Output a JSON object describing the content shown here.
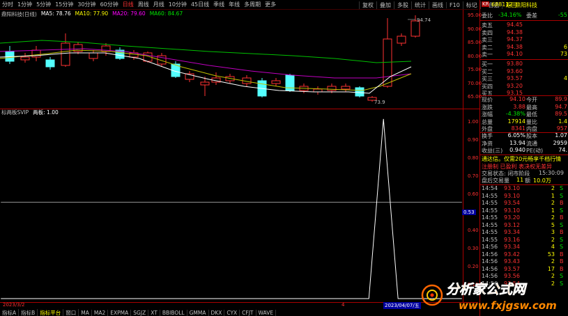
{
  "periods": [
    "分时",
    "1分钟",
    "5分钟",
    "15分钟",
    "30分钟",
    "60分钟",
    "日线",
    "周线",
    "月线",
    "10分钟",
    "45日线",
    "季线",
    "年线",
    "多周期",
    "更多"
  ],
  "active_period": "日线",
  "toolbar": [
    "复权",
    "叠加",
    "多股",
    "统计",
    "画线",
    "F10",
    "标记",
    "+自选",
    "返回"
  ],
  "ma": {
    "stock_label": "鼎阳科技(日线)",
    "ma5": "MA5: 78.76",
    "ma10": "MA10: 77.90",
    "ma20": "MA20: 79.60",
    "ma60": "MA60: 84.67",
    "ma5_color": "#ffffff",
    "ma10_color": "#ffff00",
    "ma20_color": "#ff00ff",
    "ma60_color": "#00e600"
  },
  "chart_labels": {
    "high_mark": "94.74",
    "low_mark": "73.9"
  },
  "price_axis": [
    "95.00",
    "90.00",
    "85.00",
    "80.00",
    "75.00",
    "70.00",
    "65.00"
  ],
  "indicator": {
    "name": "标两板SVIP",
    "param": "两板: 1.00"
  },
  "indicator_axis": [
    "1.00",
    "0.90",
    "0.80",
    "0.70",
    "0.60",
    "0.53",
    "0.40",
    "0.30",
    "0.20",
    "0.10"
  ],
  "date_left": "2023/3/2",
  "date_mark": "4",
  "date_right": "2023/04/07/五",
  "bottom_tabs": [
    "指标A",
    "指标B",
    "指标平台",
    "窗口",
    "MA",
    "MA2",
    "EXPMA",
    "SGJZ",
    "XT",
    "BBIBOLL",
    "GMMA",
    "DKX",
    "CYX",
    "CFJT",
    "WAVE"
  ],
  "active_tab": "指标平台",
  "right_panel": {
    "code": "688112",
    "name": "鼎阳科技",
    "weibi_label": "委比",
    "weibi_val": "-34.16%",
    "weicha_label": "委差",
    "weicha_val": "-55",
    "sells": [
      {
        "label": "卖五",
        "price": "94.45",
        "vol": ""
      },
      {
        "label": "卖四",
        "price": "94.38",
        "vol": ""
      },
      {
        "label": "卖三",
        "price": "94.37",
        "vol": ""
      },
      {
        "label": "卖二",
        "price": "94.38",
        "vol": "6"
      },
      {
        "label": "卖一",
        "price": "94.10",
        "vol": "73"
      }
    ],
    "buys": [
      {
        "label": "买一",
        "price": "93.80",
        "vol": ""
      },
      {
        "label": "买二",
        "price": "93.60",
        "vol": ""
      },
      {
        "label": "买三",
        "price": "93.57",
        "vol": "4"
      },
      {
        "label": "买四",
        "price": "93.20",
        "vol": ""
      },
      {
        "label": "买五",
        "price": "93.15",
        "vol": ""
      }
    ],
    "quote": [
      {
        "l1": "现价",
        "v1": "94.10",
        "l2": "今开",
        "v2": "89.9"
      },
      {
        "l1": "涨跌",
        "v1": "3.88",
        "l2": "最高",
        "v2": "94.7"
      },
      {
        "l1": "涨幅",
        "v1": "-4.38%",
        "l2": "最低",
        "v2": "89.5"
      },
      {
        "l1": "总量",
        "v1": "17914",
        "l2": "量比",
        "v2": "1.4"
      },
      {
        "l1": "外盘",
        "v1": "8341",
        "l2": "内盘",
        "v2": "957"
      }
    ],
    "quote2": [
      {
        "l1": "换手",
        "v1": "6.05%",
        "l2": "股本",
        "v2": "1.07"
      },
      {
        "l1": "净资",
        "v1": "13.94",
        "l2": "流通",
        "v2": "2959"
      },
      {
        "l1": "收益(三)",
        "v1": "0.940",
        "l2": "PE(动)",
        "v2": "74."
      }
    ],
    "notice1": "通达信。仅需20元畅享千档行情",
    "notice2": "注册制 已盈利 表决权无差异",
    "status_label": "交易状态: 闭市阶段",
    "status_time": "15:30:09",
    "after_label": "盘后交易量",
    "after_vol": "11",
    "after_amount_label": "额",
    "after_amount": "10.0万",
    "ticks": [
      {
        "t": "14:54",
        "p": "93.10",
        "v": "2",
        "d": "S"
      },
      {
        "t": "14:55",
        "p": "93.10",
        "v": "1",
        "d": "S"
      },
      {
        "t": "14:55",
        "p": "93.54",
        "v": "2",
        "d": "B"
      },
      {
        "t": "14:55",
        "p": "93.10",
        "v": "1",
        "d": "S"
      },
      {
        "t": "14:55",
        "p": "93.20",
        "v": "2",
        "d": "B"
      },
      {
        "t": "14:55",
        "p": "93.12",
        "v": "5",
        "d": "S"
      },
      {
        "t": "14:55",
        "p": "93.34",
        "v": "3",
        "d": "B"
      },
      {
        "t": "14:55",
        "p": "93.16",
        "v": "2",
        "d": "S"
      },
      {
        "t": "14:56",
        "p": "93.34",
        "v": "4",
        "d": "S"
      },
      {
        "t": "14:56",
        "p": "93.42",
        "v": "53",
        "d": "B"
      },
      {
        "t": "14:56",
        "p": "93.43",
        "v": "2",
        "d": "B"
      },
      {
        "t": "14:56",
        "p": "93.57",
        "v": "17",
        "d": "B"
      },
      {
        "t": "14:56",
        "p": "93.56",
        "v": "2",
        "d": "S"
      },
      {
        "t": "14:56",
        "p": "93.54",
        "v": "2",
        "d": "S"
      }
    ]
  },
  "watermark": {
    "cn": "分析家公式网",
    "url": "www.fxjgsw.com"
  }
}
